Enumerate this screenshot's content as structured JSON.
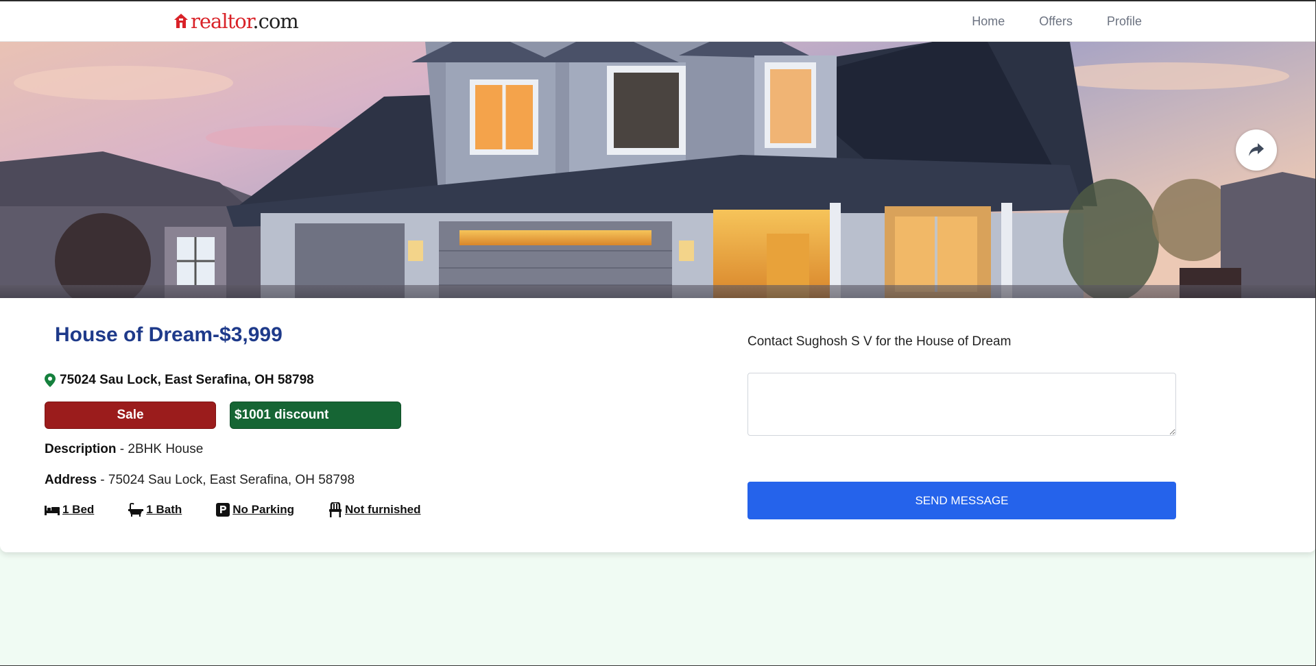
{
  "header": {
    "logo_real": "real",
    "logo_tor": "tor",
    "logo_com": ".com",
    "nav": [
      "Home",
      "Offers",
      "Profile"
    ]
  },
  "hero": {
    "share_icon": "share-arrow-icon"
  },
  "listing": {
    "title": "House of Dream-$3,999",
    "location": "75024 Sau Lock, East Serafina, OH 58798",
    "type_badge": "Sale",
    "discount_badge": "$1001 discount",
    "description_label": "Description",
    "description_value": "2BHK House",
    "address_label": "Address",
    "address_value": "75024 Sau Lock, East Serafina, OH 58798",
    "separator": " - ",
    "features": [
      {
        "icon": "bed-icon",
        "label": "1 Bed"
      },
      {
        "icon": "bath-icon",
        "label": "1 Bath"
      },
      {
        "icon": "parking-icon",
        "label": "No Parking"
      },
      {
        "icon": "chair-icon",
        "label": "Not furnished"
      }
    ]
  },
  "contact": {
    "label": "Contact Sughosh S V for the House of Dream",
    "message_value": "",
    "send_label": "SEND MESSAGE"
  },
  "colors": {
    "title": "#1e3a8a",
    "sale_badge": "#9b1c1c",
    "discount_badge": "#166534",
    "send_button": "#2563eb",
    "location_pin": "#15803d",
    "logo_red": "#d92228",
    "page_background": "#f0fbf3"
  }
}
